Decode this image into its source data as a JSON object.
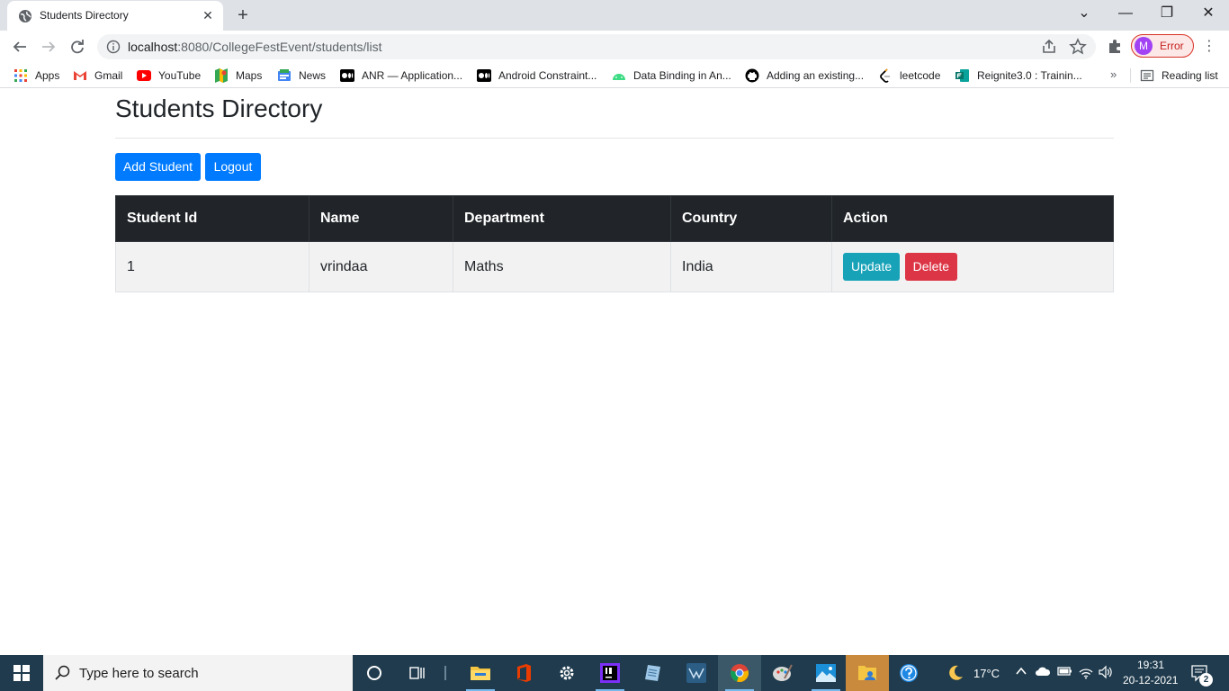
{
  "browser": {
    "tab_title": "Students Directory",
    "tab_close": "✕",
    "new_tab": "+",
    "window_controls": {
      "dropdown": "⌄",
      "minimize": "—",
      "restore": "❐",
      "close": "✕"
    },
    "url_host": "localhost",
    "url_path": ":8080/CollegeFestEvent/students/list",
    "profile_initial": "M",
    "profile_label": "Error",
    "more_menu": "⋮"
  },
  "bookmarks": {
    "items": [
      {
        "label": "Apps",
        "icon": "apps-grid-icon",
        "color": "#ea4335"
      },
      {
        "label": "Gmail",
        "icon": "gmail-icon",
        "color": "#ea4335"
      },
      {
        "label": "YouTube",
        "icon": "youtube-icon",
        "color": "#ff0000"
      },
      {
        "label": "Maps",
        "icon": "maps-icon",
        "color": "#34a853"
      },
      {
        "label": "News",
        "icon": "news-icon",
        "color": "#4285f4"
      },
      {
        "label": "ANR — Application...",
        "icon": "medium-icon",
        "color": "#000000"
      },
      {
        "label": "Android Constraint...",
        "icon": "medium-icon",
        "color": "#000000"
      },
      {
        "label": "Data Binding in An...",
        "icon": "android-icon",
        "color": "#3ddc84"
      },
      {
        "label": "Adding an existing...",
        "icon": "github-icon",
        "color": "#000000"
      },
      {
        "label": "leetcode",
        "icon": "leetcode-icon",
        "color": "#f89f1b"
      },
      {
        "label": "Reignite3.0 : Trainin...",
        "icon": "forms-icon",
        "color": "#077568"
      }
    ],
    "more": "»",
    "reading_list": "Reading list"
  },
  "page": {
    "title": "Students Directory",
    "add_button": "Add Student",
    "logout_button": "Logout",
    "table": {
      "headers": [
        "Student Id",
        "Name",
        "Department",
        "Country",
        "Action"
      ],
      "rows": [
        {
          "id": "1",
          "name": "vrindaa",
          "department": "Maths",
          "country": "India",
          "update": "Update",
          "delete": "Delete"
        }
      ]
    },
    "colors": {
      "primary": "#007bff",
      "info": "#17a2b8",
      "danger": "#dc3545",
      "header_dark": "#212529"
    }
  },
  "taskbar": {
    "search_placeholder": "Type here to search",
    "weather": "17°C",
    "time": "19:31",
    "date": "20-12-2021",
    "notifications": "2"
  }
}
